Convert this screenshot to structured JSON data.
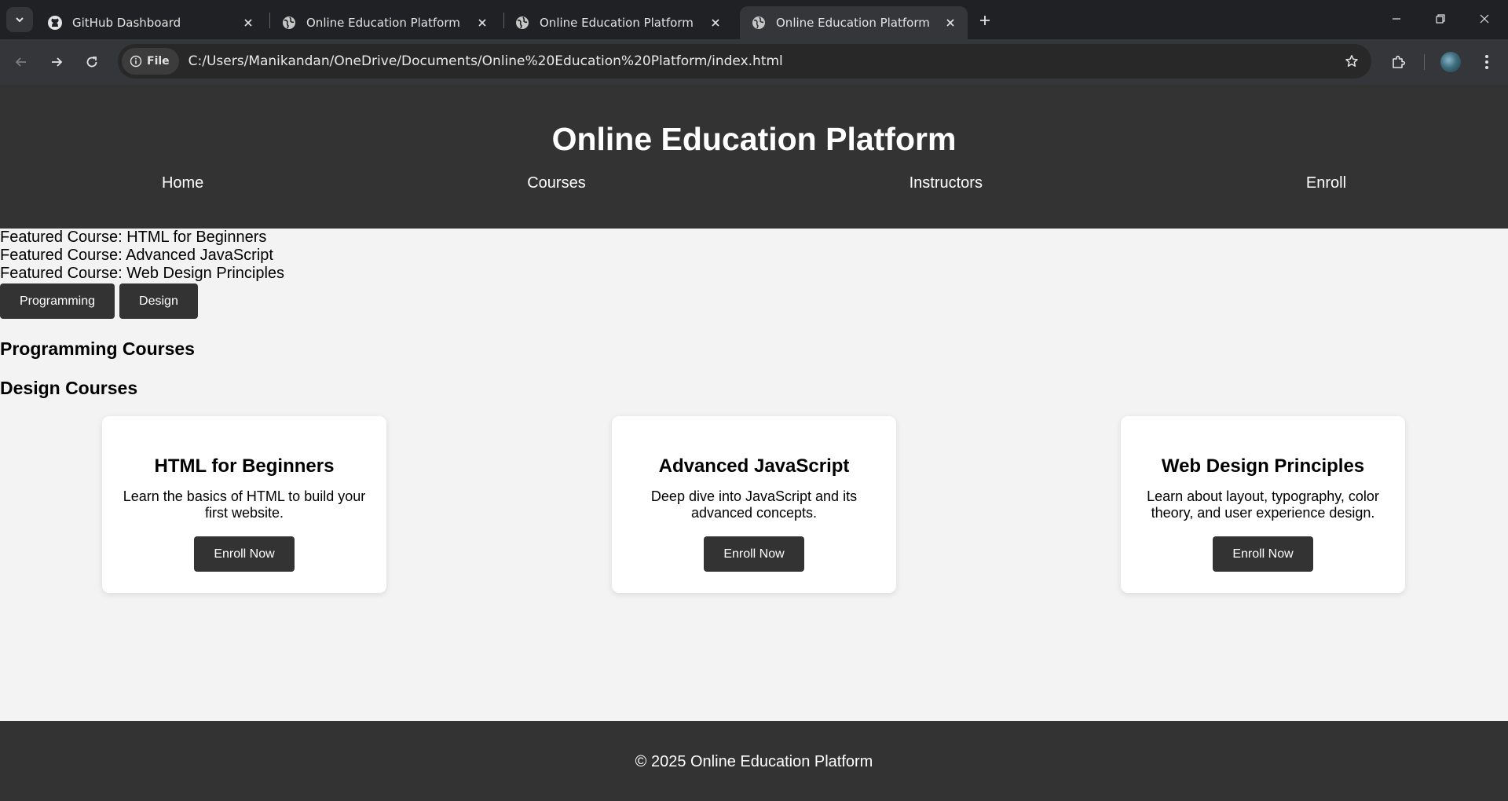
{
  "browser": {
    "tabs": [
      {
        "title": "GitHub Dashboard",
        "icon": "github-icon",
        "active": false
      },
      {
        "title": "Online Education Platform",
        "icon": "globe-icon",
        "active": false
      },
      {
        "title": "Online Education Platform",
        "icon": "globe-icon",
        "active": false
      },
      {
        "title": "Online Education Platform",
        "icon": "globe-icon",
        "active": true
      }
    ],
    "site_chip": "File",
    "url": "C:/Users/Manikandan/OneDrive/Documents/Online%20Education%20Platform/index.html"
  },
  "site": {
    "title": "Online Education Platform",
    "nav": [
      "Home",
      "Courses",
      "Instructors",
      "Enroll"
    ],
    "featured": [
      "Featured Course: HTML for Beginners",
      "Featured Course: Advanced JavaScript",
      "Featured Course: Web Design Principles"
    ],
    "category_buttons": [
      "Programming",
      "Design"
    ],
    "sections": {
      "programming": "Programming Courses",
      "design": "Design Courses"
    },
    "courses": [
      {
        "title": "HTML for Beginners",
        "description": "Learn the basics of HTML to build your first website.",
        "button": "Enroll Now"
      },
      {
        "title": "Advanced JavaScript",
        "description": "Deep dive into JavaScript and its advanced concepts.",
        "button": "Enroll Now"
      },
      {
        "title": "Web Design Principles",
        "description": "Learn about layout, typography, color theory, and user experience design.",
        "button": "Enroll Now"
      }
    ],
    "footer": "© 2025 Online Education Platform"
  },
  "colors": {
    "header_bg": "#333333",
    "page_bg": "#f3f3f3",
    "card_bg": "#ffffff",
    "chrome_dark": "#202124"
  }
}
